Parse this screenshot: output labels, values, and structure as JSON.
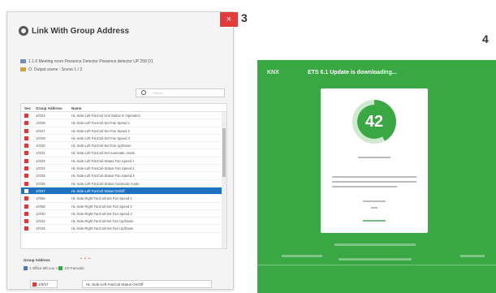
{
  "step_labels": {
    "left": "3",
    "right": "4"
  },
  "dialog": {
    "title": "Link With Group Address",
    "close": "×",
    "path_line1": "1.1.6 Meeting room Presence Detector Presence detector UP 258 D1",
    "path_line2": "O: Output scene - Scene 1 / 2",
    "search_placeholder": "Search",
    "columns": {
      "sec": "Sec",
      "address": "Group Address",
      "name": "Name"
    },
    "rows": [
      {
        "address": "1/0/22",
        "name": "HL-Side-Left FanCoil Unit Status In Operation"
      },
      {
        "address": "1/0/26",
        "name": "HL-Side-Left FanCoil-Set Fan Speed 1"
      },
      {
        "address": "1/0/27",
        "name": "HL-Side-Left FanCoil-Set Fan Speed 2"
      },
      {
        "address": "1/0/28",
        "name": "HL-Side-Left FanCoil-Set Fan Speed 3"
      },
      {
        "address": "1/0/30",
        "name": "HL-Side-Left FanCoil-Set Fan Up/Down"
      },
      {
        "address": "1/0/31",
        "name": "HL-Side-Left FanCoil-Set Automatic mode"
      },
      {
        "address": "1/0/33",
        "name": "HL-Side-Left FanCoil-Status Fan Speed 1"
      },
      {
        "address": "1/0/34",
        "name": "HL-Side-Left FanCoil-Status Fan Speed 2"
      },
      {
        "address": "1/0/35",
        "name": "HL-Side-Left FanCoil-Status Fan Speed 3"
      },
      {
        "address": "1/0/36",
        "name": "HL-Side-Left FanCoil-Status Automatic mode"
      },
      {
        "address": "1/0/37",
        "name": "HL-Side-Left FanCoil Status On/Off",
        "selected": true
      },
      {
        "address": "1/0/56",
        "name": "HL-Side-Right FanCoil-Set Fan Speed 1"
      },
      {
        "address": "1/0/58",
        "name": "HL-Side-Right FanCoil-Set Fan Speed 2"
      },
      {
        "address": "1/0/40",
        "name": "HL-Side-Right FanCoil-Set Fan Speed 3"
      },
      {
        "address": "1/0/42",
        "name": "HL-Side-Right FanCoil-Set Fan Up/Down"
      },
      {
        "address": "1/0/45",
        "name": "HL-Side-Right FanCoil-Set Fan Up/Down"
      }
    ],
    "group_address_label": "Group Address",
    "crumb_a": "1 Office left Lux",
    "crumb_sep": ">",
    "crumb_b": "1/0 Fancoils",
    "selected_address": "1/0/37",
    "selected_name": "HL-Side-Left FanCoil Status On/Off"
  },
  "update_screen": {
    "brand": "KNX",
    "title": "ETS 6.1 Update is downloading...",
    "progress": 42,
    "progress_text": "42"
  }
}
